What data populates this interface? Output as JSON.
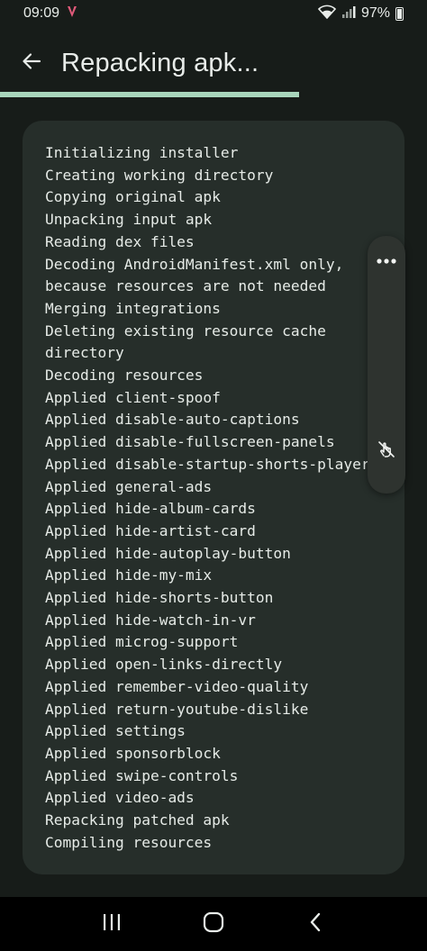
{
  "status_bar": {
    "time": "09:09",
    "battery": "97%",
    "icons": [
      "app-logo-icon",
      "wifi-icon",
      "signal-icon",
      "battery-icon"
    ]
  },
  "app_bar": {
    "title": "Repacking apk...",
    "back_icon": "arrow-back-icon"
  },
  "progress": {
    "value": 0.7,
    "color": "#a8d5bb"
  },
  "log": {
    "lines": [
      "Initializing installer",
      "Creating working directory",
      "Copying original apk",
      "Unpacking input apk",
      "Reading dex files",
      "Decoding AndroidManifest.xml only,",
      "because resources are not needed",
      "Merging integrations",
      "Deleting existing resource cache",
      "directory",
      "Decoding resources",
      "Applied client-spoof",
      "Applied disable-auto-captions",
      "Applied disable-fullscreen-panels",
      "Applied disable-startup-shorts-player",
      "Applied general-ads",
      "Applied hide-album-cards",
      "Applied hide-artist-card",
      "Applied hide-autoplay-button",
      "Applied hide-my-mix",
      "Applied hide-shorts-button",
      "Applied hide-watch-in-vr",
      "Applied microg-support",
      "Applied open-links-directly",
      "Applied remember-video-quality",
      "Applied return-youtube-dislike",
      "Applied settings",
      "Applied sponsorblock",
      "Applied swipe-controls",
      "Applied video-ads",
      "Repacking patched apk",
      "Compiling resources"
    ]
  },
  "floating_panel": {
    "icons": [
      "more-horizontal-icon",
      "touch-off-icon"
    ]
  },
  "nav_bar": {
    "icons": [
      "recents-icon",
      "home-icon",
      "back-icon"
    ]
  },
  "colors": {
    "background": "#171c19",
    "card": "#262e2a",
    "accent": "#a8d5bb",
    "text": "#e6ebe7"
  }
}
